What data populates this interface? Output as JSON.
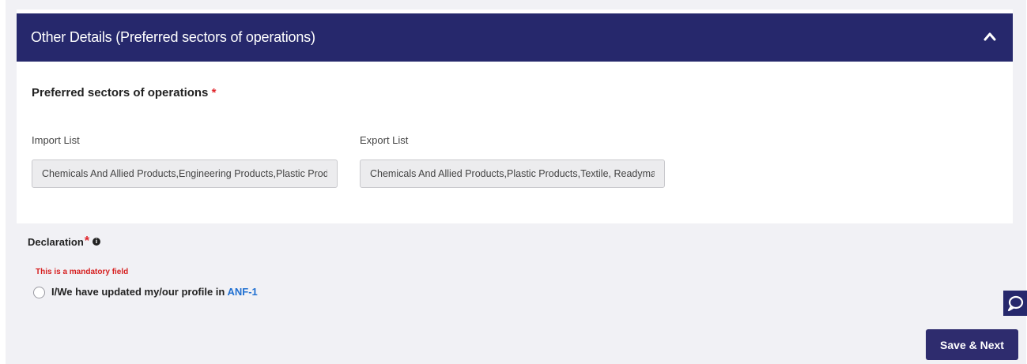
{
  "panel": {
    "title": "Other Details (Preferred sectors of operations)"
  },
  "section": {
    "title": "Preferred sectors of operations",
    "required_mark": "*"
  },
  "import_field": {
    "label": "Import List",
    "value": "Chemicals And Allied Products,Engineering Products,Plastic Products"
  },
  "export_field": {
    "label": "Export List",
    "value": "Chemicals And Allied Products,Plastic Products,Textile, Readymade garments"
  },
  "declaration": {
    "label": "Declaration",
    "required_mark": "*",
    "info_glyph": "i",
    "error": "This is a mandatory field",
    "statement": "I/We have updated my/our profile in ",
    "link_text": "ANF-1",
    "checked": false
  },
  "actions": {
    "save_next_label": "Save & Next"
  },
  "colors": {
    "header_bg": "#26286c",
    "button_bg": "#2e2c6e",
    "required": "#e0242a",
    "link": "#1f6fd1"
  },
  "icons": {
    "collapse": "chevron-up-icon",
    "info": "info-icon",
    "chat": "chat-icon"
  }
}
